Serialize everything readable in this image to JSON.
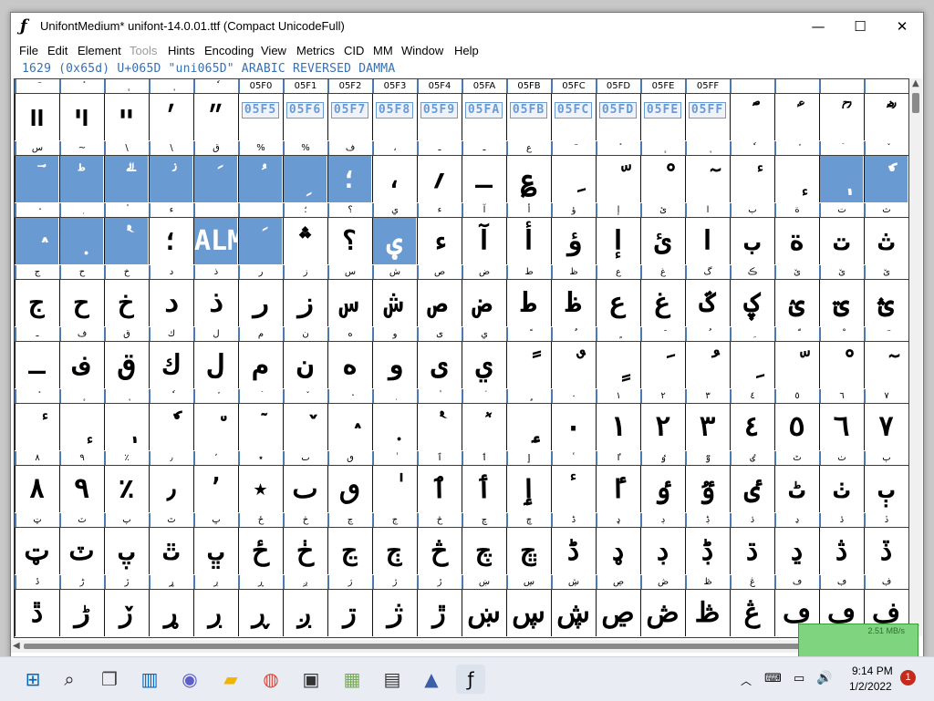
{
  "window": {
    "title": "UnifontMedium*  unifont-14.0.01.ttf (Compact UnicodeFull)",
    "minimize": "—",
    "maximize": "☐",
    "close": "✕"
  },
  "menu": [
    "File",
    "Edit",
    "Element",
    "Tools",
    "Hints",
    "Encoding",
    "View",
    "Metrics",
    "CID",
    "MM",
    "Window",
    "Help"
  ],
  "menu_disabled": [
    "Tools"
  ],
  "infobar": "1629 (0x65d) U+065D \"uni065D\" ARABIC REVERSED DAMMA",
  "rows": [
    {
      "labels": [
        "ٓ",
        "ٔ",
        "ٕ",
        "ٖ",
        "ٗ",
        "05F0",
        "05F1",
        "05F2",
        "05F3",
        "05F4",
        "05FA",
        "05FB",
        "05FC",
        "05FD",
        "05FE",
        "05FF",
        "",
        "",
        "",
        ""
      ],
      "glyphs": [
        "װ",
        "ױ",
        "ײ",
        "׳",
        "״",
        "05F5",
        "05F6",
        "05F7",
        "05F8",
        "05F9",
        "05FA",
        "05FB",
        "05FC",
        "05FD",
        "05FE",
        "05FF",
        "ؐ",
        "ؑ",
        "ؒ",
        "ؓ"
      ],
      "empty": [
        5,
        6,
        7,
        8,
        9,
        10,
        11,
        12,
        13,
        14,
        15
      ],
      "selected": []
    },
    {
      "labels": [
        "س",
        "~",
        "\\",
        "\\",
        "ق",
        "%",
        "%",
        "ف",
        "،",
        "ـ",
        "ـ",
        "ع",
        "ٓ",
        "ٔ",
        "ٕ",
        "ٖ",
        "ٗ",
        "٘",
        "ٙ",
        "ٚ"
      ],
      "glyphs": [
        "ؔ",
        "ؕ",
        "ؖ",
        "ؗ",
        "ؘ",
        "ؙ",
        "ؚ",
        "؛",
        "،",
        "؍",
        "ـ",
        "؏",
        "ِ",
        "ّ",
        "ْ",
        "ٓ",
        "ٔ",
        "ٕ",
        "ٖ",
        "ٗ"
      ],
      "empty": [],
      "selected": [
        0,
        1,
        2,
        3,
        4,
        5,
        6,
        7,
        18,
        19
      ]
    },
    {
      "labels": [
        "ٛ",
        "ٜ",
        "ٝ",
        "ء",
        "",
        "",
        "؛",
        "؟",
        "ي",
        "ء",
        "آ",
        "أ",
        "ؤ",
        "إ",
        "ئ",
        "ا",
        "ب",
        "ة",
        "ت",
        "ث"
      ],
      "glyphs": [
        "ٛ",
        "ٜ",
        "ٝ",
        "؛",
        "ALM",
        "ؘ",
        "؞",
        "؟",
        "ؠ",
        "ء",
        "آ",
        "أ",
        "ؤ",
        "إ",
        "ئ",
        "ا",
        "ب",
        "ة",
        "ت",
        "ث"
      ],
      "empty": [],
      "selected": [
        0,
        1,
        2,
        4,
        5,
        8
      ]
    },
    {
      "labels": [
        "ج",
        "ح",
        "خ",
        "د",
        "ذ",
        "ر",
        "ز",
        "س",
        "ش",
        "ص",
        "ض",
        "ط",
        "ظ",
        "ع",
        "غ",
        "گ",
        "ڪ",
        "ێ",
        "ێ",
        "ێ"
      ],
      "glyphs": [
        "ج",
        "ح",
        "خ",
        "د",
        "ذ",
        "ر",
        "ز",
        "س",
        "ش",
        "ص",
        "ض",
        "ط",
        "ظ",
        "ع",
        "غ",
        "ػ",
        "ؼ",
        "ؽ",
        "ؾ",
        "ؿ"
      ],
      "empty": [],
      "selected": []
    },
    {
      "labels": [
        "ـ",
        "ف",
        "ق",
        "ك",
        "ل",
        "م",
        "ن",
        "ه",
        "و",
        "ى",
        "ي",
        "ً",
        "ٌ",
        "ٍ",
        "َ",
        "ُ",
        "ِ",
        "ّ",
        "ْ",
        "ٓ"
      ],
      "glyphs": [
        "ـ",
        "ف",
        "ق",
        "ك",
        "ل",
        "م",
        "ن",
        "ه",
        "و",
        "ى",
        "ي",
        "ً",
        "ٌ",
        "ٍ",
        "َ",
        "ُ",
        "ِ",
        "ّ",
        "ْ",
        "ٓ"
      ],
      "empty": [],
      "selected": []
    },
    {
      "labels": [
        "ٔ",
        "ٕ",
        "ٖ",
        "ٗ",
        "٘",
        "ٙ",
        "ٚ",
        "ٛ",
        "ٜ",
        "ٝ",
        "ٞ",
        "ٟ",
        "٠",
        "١",
        "٢",
        "٣",
        "٤",
        "٥",
        "٦",
        "٧"
      ],
      "glyphs": [
        "ٔ",
        "ٕ",
        "ٖ",
        "ٗ",
        "٘",
        "ٙ",
        "ٚ",
        "ٛ",
        "ٜ",
        "ٝ",
        "ٞ",
        "ٟ",
        "٠",
        "١",
        "٢",
        "٣",
        "٤",
        "٥",
        "٦",
        "٧"
      ],
      "empty": [],
      "selected": []
    },
    {
      "labels": [
        "٨",
        "٩",
        "٪",
        "٫",
        "٬",
        "٭",
        "ٮ",
        "ٯ",
        "ٰ",
        "ٱ",
        "ٲ",
        "ٳ",
        "ٴ",
        "ٵ",
        "ٶ",
        "ٷ",
        "ٸ",
        "ٹ",
        "ٺ",
        "ٻ"
      ],
      "glyphs": [
        "٨",
        "٩",
        "٪",
        "٫",
        "٬",
        "٭",
        "ٮ",
        "ٯ",
        "ٰ",
        "ٱ",
        "ٲ",
        "ٳ",
        "ٴ",
        "ٵ",
        "ٶ",
        "ٷ",
        "ٸ",
        "ٹ",
        "ٺ",
        "ٻ"
      ],
      "empty": [],
      "selected": []
    },
    {
      "labels": [
        "ټ",
        "ٽ",
        "پ",
        "ٿ",
        "ڀ",
        "ځ",
        "ڂ",
        "ڃ",
        "ڄ",
        "څ",
        "چ",
        "ڇ",
        "ڈ",
        "ډ",
        "ڊ",
        "ڋ",
        "ڌ",
        "ڍ",
        "ڎ",
        "ڏ"
      ],
      "glyphs": [
        "ټ",
        "ٽ",
        "پ",
        "ٿ",
        "ڀ",
        "ځ",
        "ڂ",
        "ڃ",
        "ڄ",
        "څ",
        "چ",
        "ڇ",
        "ڈ",
        "ډ",
        "ڊ",
        "ڋ",
        "ڌ",
        "ڍ",
        "ڎ",
        "ڏ"
      ],
      "empty": [],
      "selected": []
    },
    {
      "labels": [
        "ڐ",
        "ڑ",
        "ڒ",
        "ړ",
        "ڔ",
        "ڕ",
        "ږ",
        "ڗ",
        "ژ",
        "ڙ",
        "ښ",
        "ڛ",
        "ڜ",
        "ڝ",
        "ڞ",
        "ڟ",
        "ڠ",
        "ڡ",
        "ڢ",
        "ڣ"
      ],
      "glyphs": [
        "ڐ",
        "ڑ",
        "ڒ",
        "ړ",
        "ڔ",
        "ڕ",
        "ږ",
        "ڗ",
        "ژ",
        "ڙ",
        "ښ",
        "ڛ",
        "ڜ",
        "ڝ",
        "ڞ",
        "ڟ",
        "ڠ",
        "ڡ",
        "ڢ",
        "ڣ"
      ],
      "empty": [],
      "selected": []
    }
  ],
  "netmon": "2.51 MB/s",
  "taskbar": {
    "icons": [
      "windows-start-icon",
      "search-icon",
      "task-view-icon",
      "widgets-icon",
      "chat-icon",
      "file-explorer-icon",
      "chrome-icon",
      "store-icon",
      "archive-tool-icon",
      "7zip-icon",
      "inkscape-icon",
      "fontforge-icon"
    ],
    "time": "9:14 PM",
    "date": "1/2/2022",
    "notifications": "1"
  }
}
